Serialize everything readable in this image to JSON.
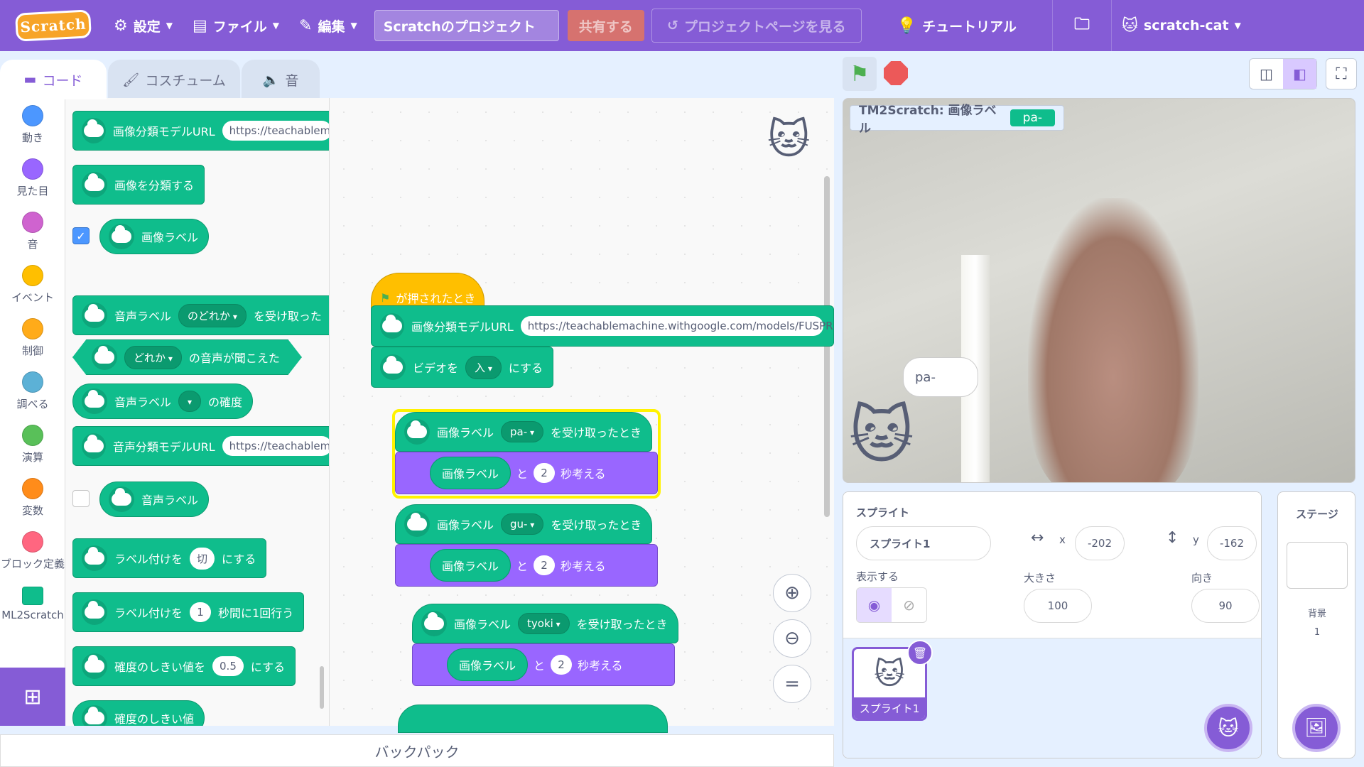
{
  "menu": {
    "logo": "Scratch",
    "settings": "設定",
    "file": "ファイル",
    "edit": "編集",
    "project_title": "Scratchのプロジェクト",
    "share": "共有する",
    "see_project_page": "プロジェクトページを見る",
    "tutorials": "チュートリアル",
    "username": "scratch-cat"
  },
  "tabs": {
    "code": "コード",
    "costumes": "コスチューム",
    "sounds": "音"
  },
  "categories": [
    {
      "label": "動き",
      "color": "#4c97ff"
    },
    {
      "label": "見た目",
      "color": "#9966ff"
    },
    {
      "label": "音",
      "color": "#cf63cf"
    },
    {
      "label": "イベント",
      "color": "#ffbf00"
    },
    {
      "label": "制御",
      "color": "#ffab19"
    },
    {
      "label": "調べる",
      "color": "#5cb1d6"
    },
    {
      "label": "演算",
      "color": "#59c059"
    },
    {
      "label": "変数",
      "color": "#ff8c1a"
    },
    {
      "label": "ブロック定義",
      "color": "#ff6680"
    },
    {
      "label": "ML2Scratch",
      "color": "#0fbd8c"
    }
  ],
  "palette": {
    "img_model_url": "画像分類モデルURL",
    "img_model_url_value": "https://teachablem",
    "classify": "画像を分類する",
    "img_label": "画像ラベル",
    "sound_label": "音声ラベル",
    "any": "のどれか",
    "received": "を受け取った",
    "any2": "どれか",
    "heard": "の音声が聞こえた",
    "confidence": "の確度",
    "sound_model_url": "音声分類モデルURL",
    "sound_model_url_value": "https://teachablem",
    "labeling": "ラベル付けを",
    "off": "切",
    "do": "にする",
    "one": "1",
    "per_sec": "秒間に1回行う",
    "threshold": "確度のしきい値を",
    "threshold_value": "0.5",
    "threshold_reporter": "確度のしきい値"
  },
  "script": {
    "flag_clicked": "が押されたとき",
    "img_model_url": "画像分類モデルURL",
    "model_url": "https://teachablemachine.withgoogle.com/models/FUSPR",
    "video": "ビデオを",
    "on": "入",
    "do": "にする",
    "events": [
      {
        "label": "pa-",
        "when": "を受け取ったとき",
        "secs": "2"
      },
      {
        "label": "gu-",
        "when": "を受け取ったとき",
        "secs": "2"
      },
      {
        "label": "tyoki",
        "when": "を受け取ったとき",
        "secs": "2"
      }
    ],
    "img_label": "画像ラベル",
    "and": "と",
    "think": "秒考える"
  },
  "stage": {
    "monitor_label": "TM2Scratch: 画像ラベル",
    "monitor_value": "pa-",
    "bubble": "pa-"
  },
  "sprite": {
    "heading": "スプライト",
    "name": "スプライト1",
    "x_label": "x",
    "x": "-202",
    "y_label": "y",
    "y": "-162",
    "show_label": "表示する",
    "size_label": "大きさ",
    "size": "100",
    "direction_label": "向き",
    "direction": "90",
    "thumb_name": "スプライト1"
  },
  "stage_pane": {
    "title": "ステージ",
    "backdrops": "背景",
    "count": "1"
  },
  "backpack": "バックパック"
}
